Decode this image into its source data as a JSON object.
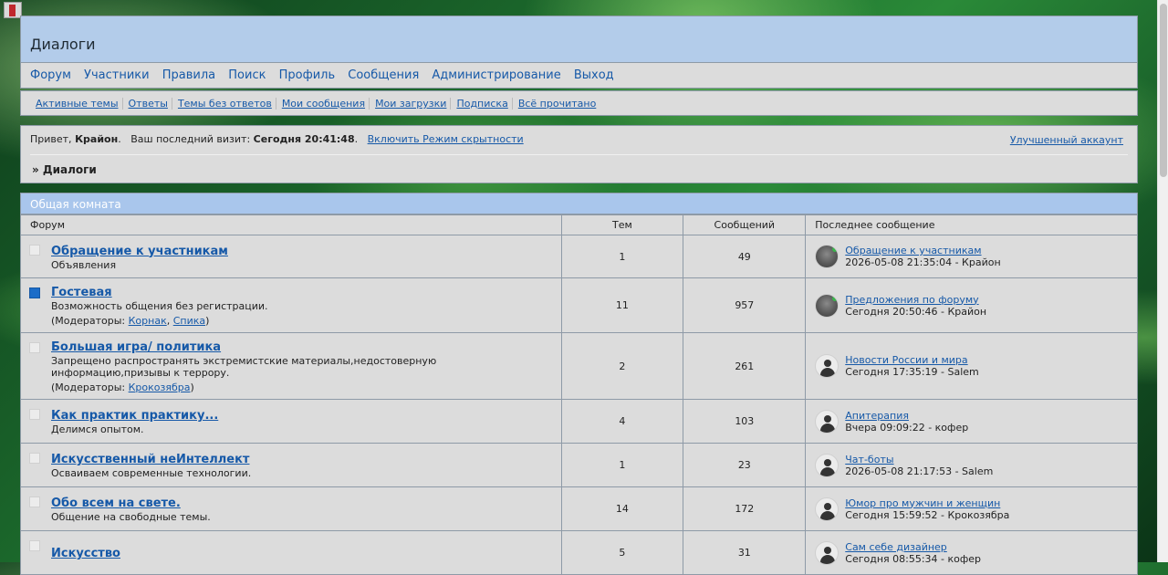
{
  "site": {
    "title": "Диалоги"
  },
  "nav": {
    "items": [
      "Форум",
      "Участники",
      "Правила",
      "Поиск",
      "Профиль",
      "Сообщения",
      "Администрирование",
      "Выход"
    ]
  },
  "subnav": {
    "items": [
      "Активные темы",
      "Ответы",
      "Темы без ответов",
      "Мои сообщения",
      "Мои загрузки",
      "Подписка",
      "Всё прочитано"
    ]
  },
  "welcome": {
    "greeting": "Привет,",
    "username": "Крайон",
    "last_visit_label": "Ваш последний визит:",
    "last_visit_value": "Сегодня 20:41:48",
    "stealth_link": "Включить Режим скрытности",
    "premium_link": "Улучшенный аккаунт"
  },
  "breadcrumb": "» Диалоги",
  "category": {
    "title": "Общая комната"
  },
  "columns": {
    "forum": "Форум",
    "topics": "Тем",
    "posts": "Сообщений",
    "last_post": "Последнее сообщение"
  },
  "forums": [
    {
      "title": "Обращение к участникам",
      "desc": "Объявления",
      "mods_label": "",
      "mods": [],
      "topics": "1",
      "posts": "49",
      "last_topic": "Обращение к участникам",
      "last_time": "2026-05-08 21:35:04 - Крайон",
      "status": "read",
      "avatar": "photo"
    },
    {
      "title": "Гостевая",
      "desc": "Возможность общения без регистрации.",
      "mods_label": "(Модераторы:",
      "mods": [
        "Корнак",
        "Спика"
      ],
      "topics": "11",
      "posts": "957",
      "last_topic": "Предложения по форуму",
      "last_time": "Сегодня 20:50:46 - Крайон",
      "status": "new",
      "avatar": "photo"
    },
    {
      "title": "Большая игра/ политика",
      "desc": "Запрещено распространять экстремистские материалы,недостоверную информацию,призывы к террору.",
      "mods_label": "(Модераторы:",
      "mods": [
        "Крокозябра"
      ],
      "topics": "2",
      "posts": "261",
      "last_topic": "Новости России и мира",
      "last_time": "Сегодня 17:35:19 - Salem",
      "status": "read",
      "avatar": "default"
    },
    {
      "title": "Как практик практику...",
      "desc": "Делимся опытом.",
      "mods_label": "",
      "mods": [],
      "topics": "4",
      "posts": "103",
      "last_topic": "Апитерапия",
      "last_time": "Вчера 09:09:22 - кофер",
      "status": "read",
      "avatar": "default"
    },
    {
      "title": "Искусственный неИнтеллект",
      "desc": "Осваиваем современные технологии.",
      "mods_label": "",
      "mods": [],
      "topics": "1",
      "posts": "23",
      "last_topic": "Чат-боты",
      "last_time": "2026-05-08 21:17:53 - Salem",
      "status": "read",
      "avatar": "default"
    },
    {
      "title": "Обо всем на свете.",
      "desc": "Общение на свободные темы.",
      "mods_label": "",
      "mods": [],
      "topics": "14",
      "posts": "172",
      "last_topic": "Юмор про мужчин и женщин",
      "last_time": "Сегодня 15:59:52 - Крокозябра",
      "status": "read",
      "avatar": "default"
    },
    {
      "title": "Искусство",
      "desc": "",
      "mods_label": "",
      "mods": [],
      "topics": "5",
      "posts": "31",
      "last_topic": "Сам себе дизайнер",
      "last_time": "Сегодня 08:55:34 - кофер",
      "status": "read",
      "avatar": "default"
    }
  ]
}
